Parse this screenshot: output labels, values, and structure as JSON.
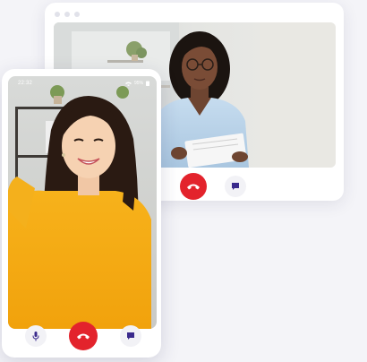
{
  "desktop_window": {
    "controls": {
      "mic_icon": "microphone-icon",
      "end_call_icon": "phone-hangup-icon",
      "chat_icon": "chat-icon"
    }
  },
  "phone": {
    "status_bar": {
      "time": "22:32",
      "battery": "95%"
    },
    "controls": {
      "mic_icon": "microphone-icon",
      "end_call_icon": "phone-hangup-icon",
      "chat_icon": "chat-icon"
    }
  },
  "colors": {
    "end_call": "#e3232c",
    "icon": "#3a2a8c",
    "control_bg": "#f2f2f6",
    "page_bg": "#f4f4f8"
  }
}
